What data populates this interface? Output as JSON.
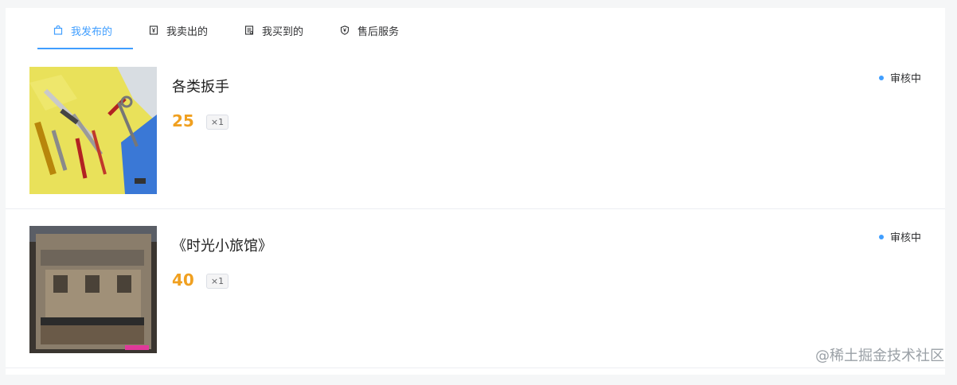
{
  "tabs": [
    {
      "label": "我发布的",
      "icon": "shopping-bag-icon",
      "active": true
    },
    {
      "label": "我卖出的",
      "icon": "receipt-icon",
      "active": false
    },
    {
      "label": "我买到的",
      "icon": "document-icon",
      "active": false
    },
    {
      "label": "售后服务",
      "icon": "shield-yen-icon",
      "active": false
    }
  ],
  "orders": [
    {
      "title": "各类扳手",
      "price": "25",
      "quantity": "×1",
      "status": "审核中",
      "image": "tools-photo"
    },
    {
      "title": "《时光小旅馆》",
      "price": "40",
      "quantity": "×1",
      "status": "审核中",
      "image": "book-photo"
    }
  ],
  "watermark": "@稀土掘金技术社区",
  "colors": {
    "accent": "#409eff",
    "price": "#f0a020",
    "status_dot": "#409eff",
    "page_bg": "#f5f6f7"
  }
}
